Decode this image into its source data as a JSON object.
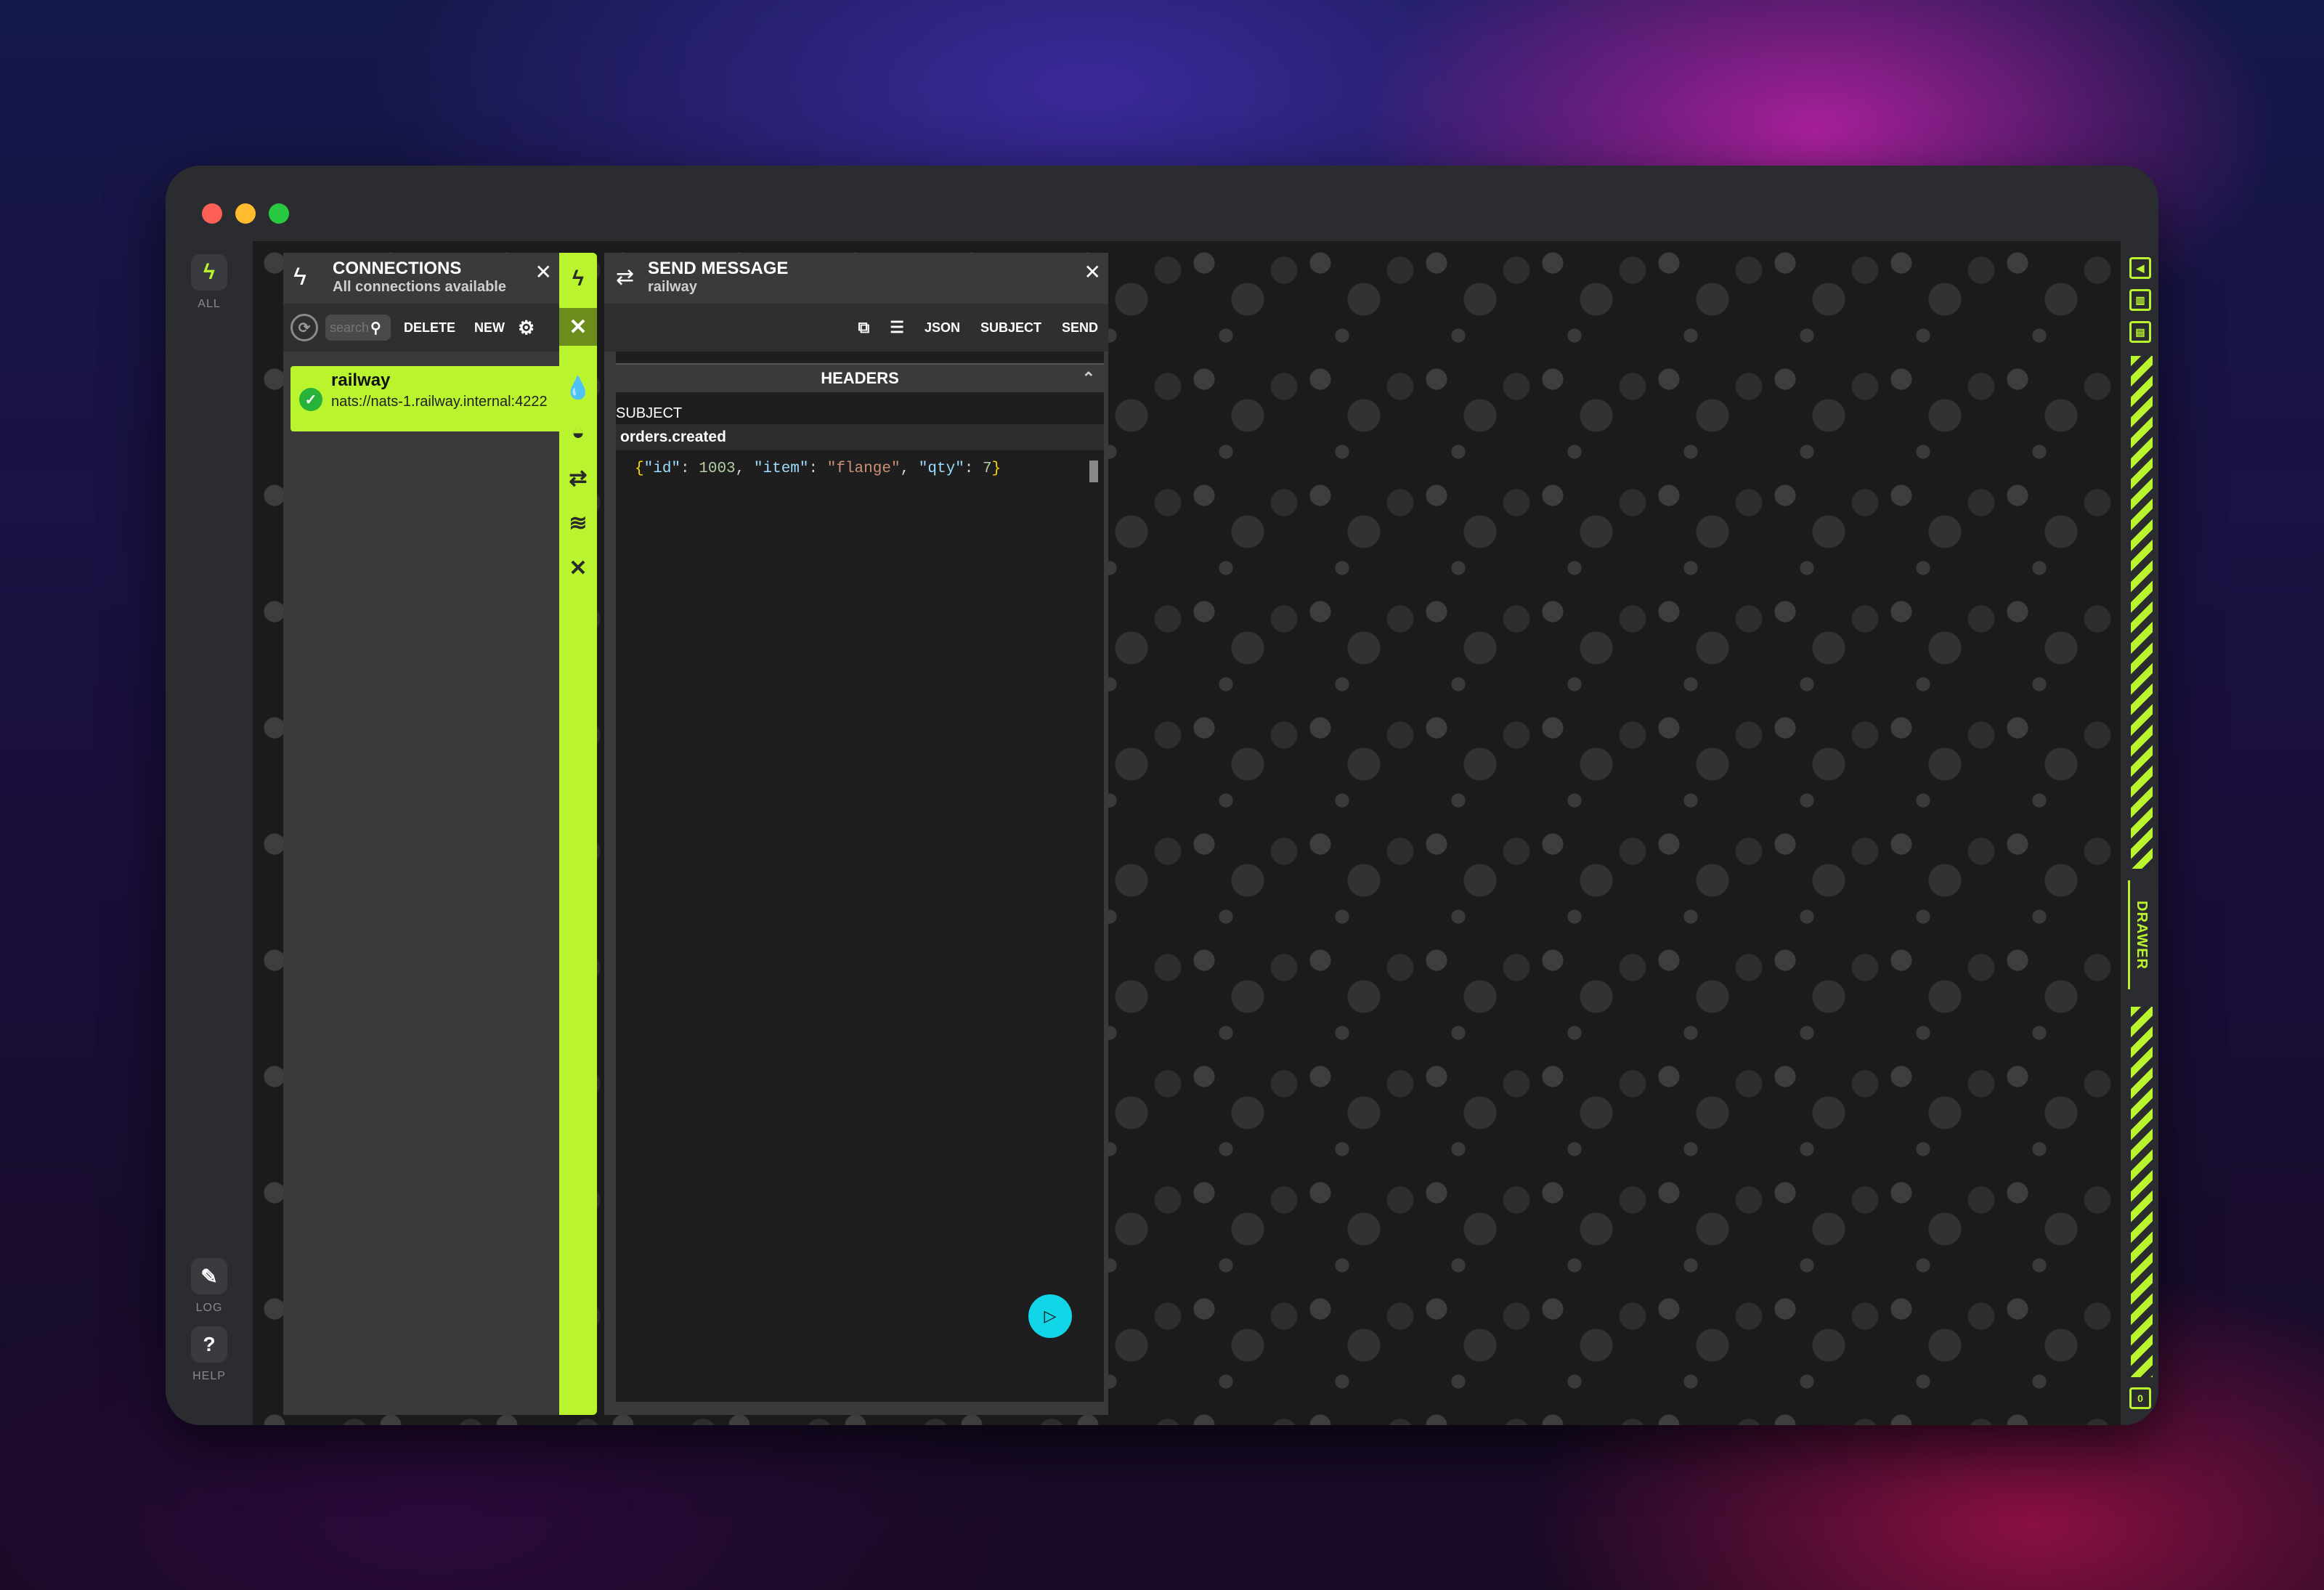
{
  "leftbar": {
    "all_label": "ALL",
    "log_label": "LOG",
    "help_label": "HELP",
    "help_symbol": "?"
  },
  "connections": {
    "title": "CONNECTIONS",
    "subtitle": "All connections available",
    "search_placeholder": "search",
    "delete_label": "DELETE",
    "new_label": "NEW",
    "items": [
      {
        "name": "railway",
        "url": "nats://nats-1.railway.internal:4222",
        "status": "connected"
      }
    ]
  },
  "send_message": {
    "title": "SEND MESSAGE",
    "subtitle": "railway",
    "json_label": "JSON",
    "subject_label": "SUBJECT",
    "send_label": "SEND",
    "headers_label": "HEADERS",
    "subject_field_label": "SUBJECT",
    "subject_value": "orders.created",
    "payload": "{\"id\": 1003, \"item\": \"flange\", \"qty\": 7}"
  },
  "rightbar": {
    "drawer_label": "DRAWER",
    "bottom_badge": "0"
  },
  "colors": {
    "accent": "#b9f42f",
    "play": "#12d6e8",
    "success": "#27b33a"
  }
}
